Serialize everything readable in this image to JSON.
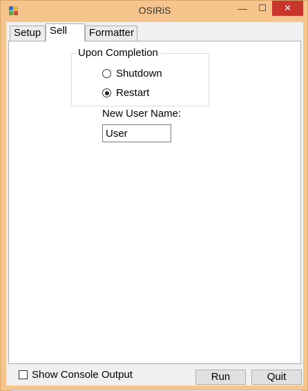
{
  "window": {
    "title": "OSIRiS"
  },
  "tabs": [
    {
      "label": "Setup"
    },
    {
      "label": "Sell",
      "active": true
    },
    {
      "label": "Formatter"
    }
  ],
  "completion": {
    "legend": "Upon Completion",
    "options": [
      {
        "label": "Shutdown",
        "checked": false
      },
      {
        "label": "Restart",
        "checked": true
      }
    ]
  },
  "user": {
    "label": "New User Name:",
    "value": "User"
  },
  "console": {
    "label": "Show Console Output",
    "checked": false
  },
  "buttons": {
    "run": "Run",
    "quit": "Quit"
  },
  "controls": {
    "minimize": "—",
    "maximize": "☐",
    "close": "✕"
  },
  "colors": {
    "frame": "#f6c58d",
    "close": "#c7352b"
  }
}
